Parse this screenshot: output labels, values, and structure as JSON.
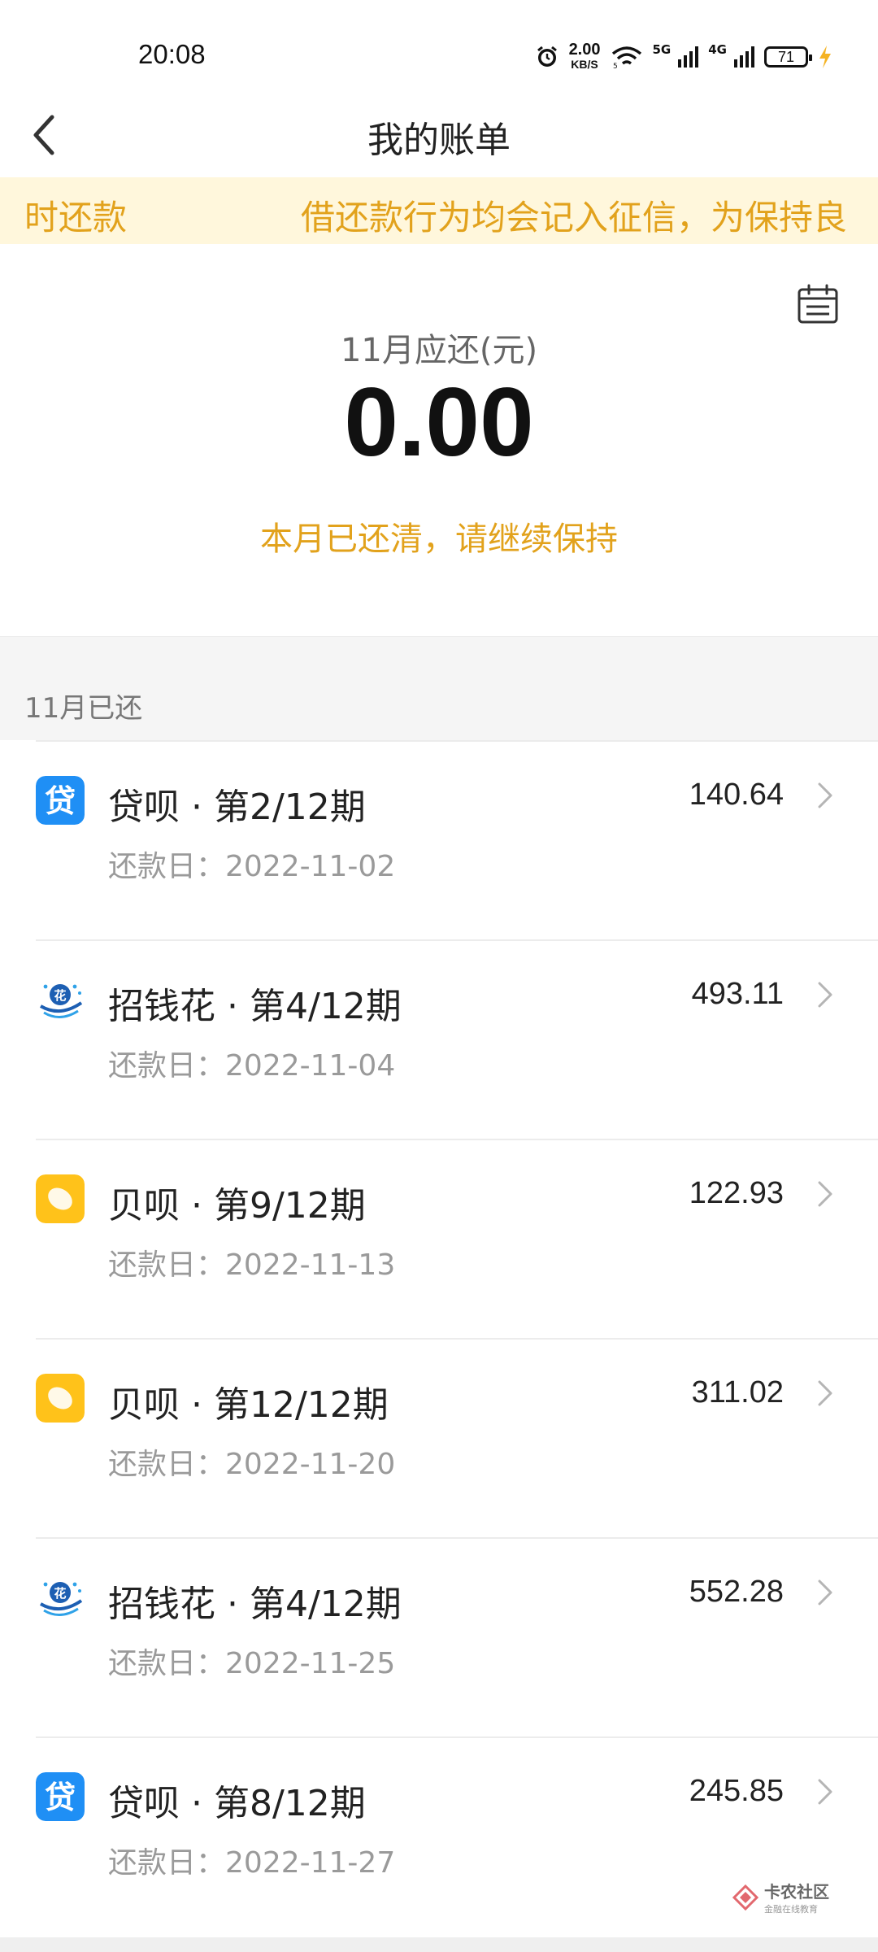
{
  "status_bar": {
    "time": "20:08",
    "net_speed_value": "2.00",
    "net_speed_unit": "KB/S",
    "signal_1_label": "5G",
    "signal_2_label": "4G",
    "battery_level": "71",
    "icons": [
      "alarm-icon",
      "wifi-icon",
      "signal-5g-icon",
      "signal-4g-icon",
      "battery-icon",
      "charging-icon"
    ]
  },
  "nav": {
    "title": "我的账单",
    "back_icon": "back-arrow-icon"
  },
  "notice": {
    "text_left": "时还款",
    "text_right": "借还款行为均会记入征信，为保持良"
  },
  "summary": {
    "due_label": "11月应还(元)",
    "due_amount": "0.00",
    "status_text": "本月已还清，请继续保持",
    "calendar_icon": "calendar-icon"
  },
  "section": {
    "title": "11月已还"
  },
  "bills": [
    {
      "app": "daibei",
      "name": "贷呗 · 第2/12期",
      "date_label": "还款日：",
      "date": "2022-11-02",
      "amount": "140.64"
    },
    {
      "app": "zhaoqianhua",
      "name": "招钱花 · 第4/12期",
      "date_label": "还款日：",
      "date": "2022-11-04",
      "amount": "493.11"
    },
    {
      "app": "beibei",
      "name": "贝呗 · 第9/12期",
      "date_label": "还款日：",
      "date": "2022-11-13",
      "amount": "122.93"
    },
    {
      "app": "beibei",
      "name": "贝呗 · 第12/12期",
      "date_label": "还款日：",
      "date": "2022-11-20",
      "amount": "311.02"
    },
    {
      "app": "zhaoqianhua",
      "name": "招钱花 · 第4/12期",
      "date_label": "还款日：",
      "date": "2022-11-25",
      "amount": "552.28"
    },
    {
      "app": "daibei",
      "name": "贷呗 · 第8/12期",
      "date_label": "还款日：",
      "date": "2022-11-27",
      "amount": "245.85"
    }
  ],
  "watermark": {
    "main": "卡农社区",
    "sub": "金融在线教育"
  },
  "colors": {
    "accent": "#e2a21c",
    "notice_bg": "#fff7dc",
    "daibei_blue": "#1f8ff5",
    "beibei_yellow": "#ffc21a"
  }
}
